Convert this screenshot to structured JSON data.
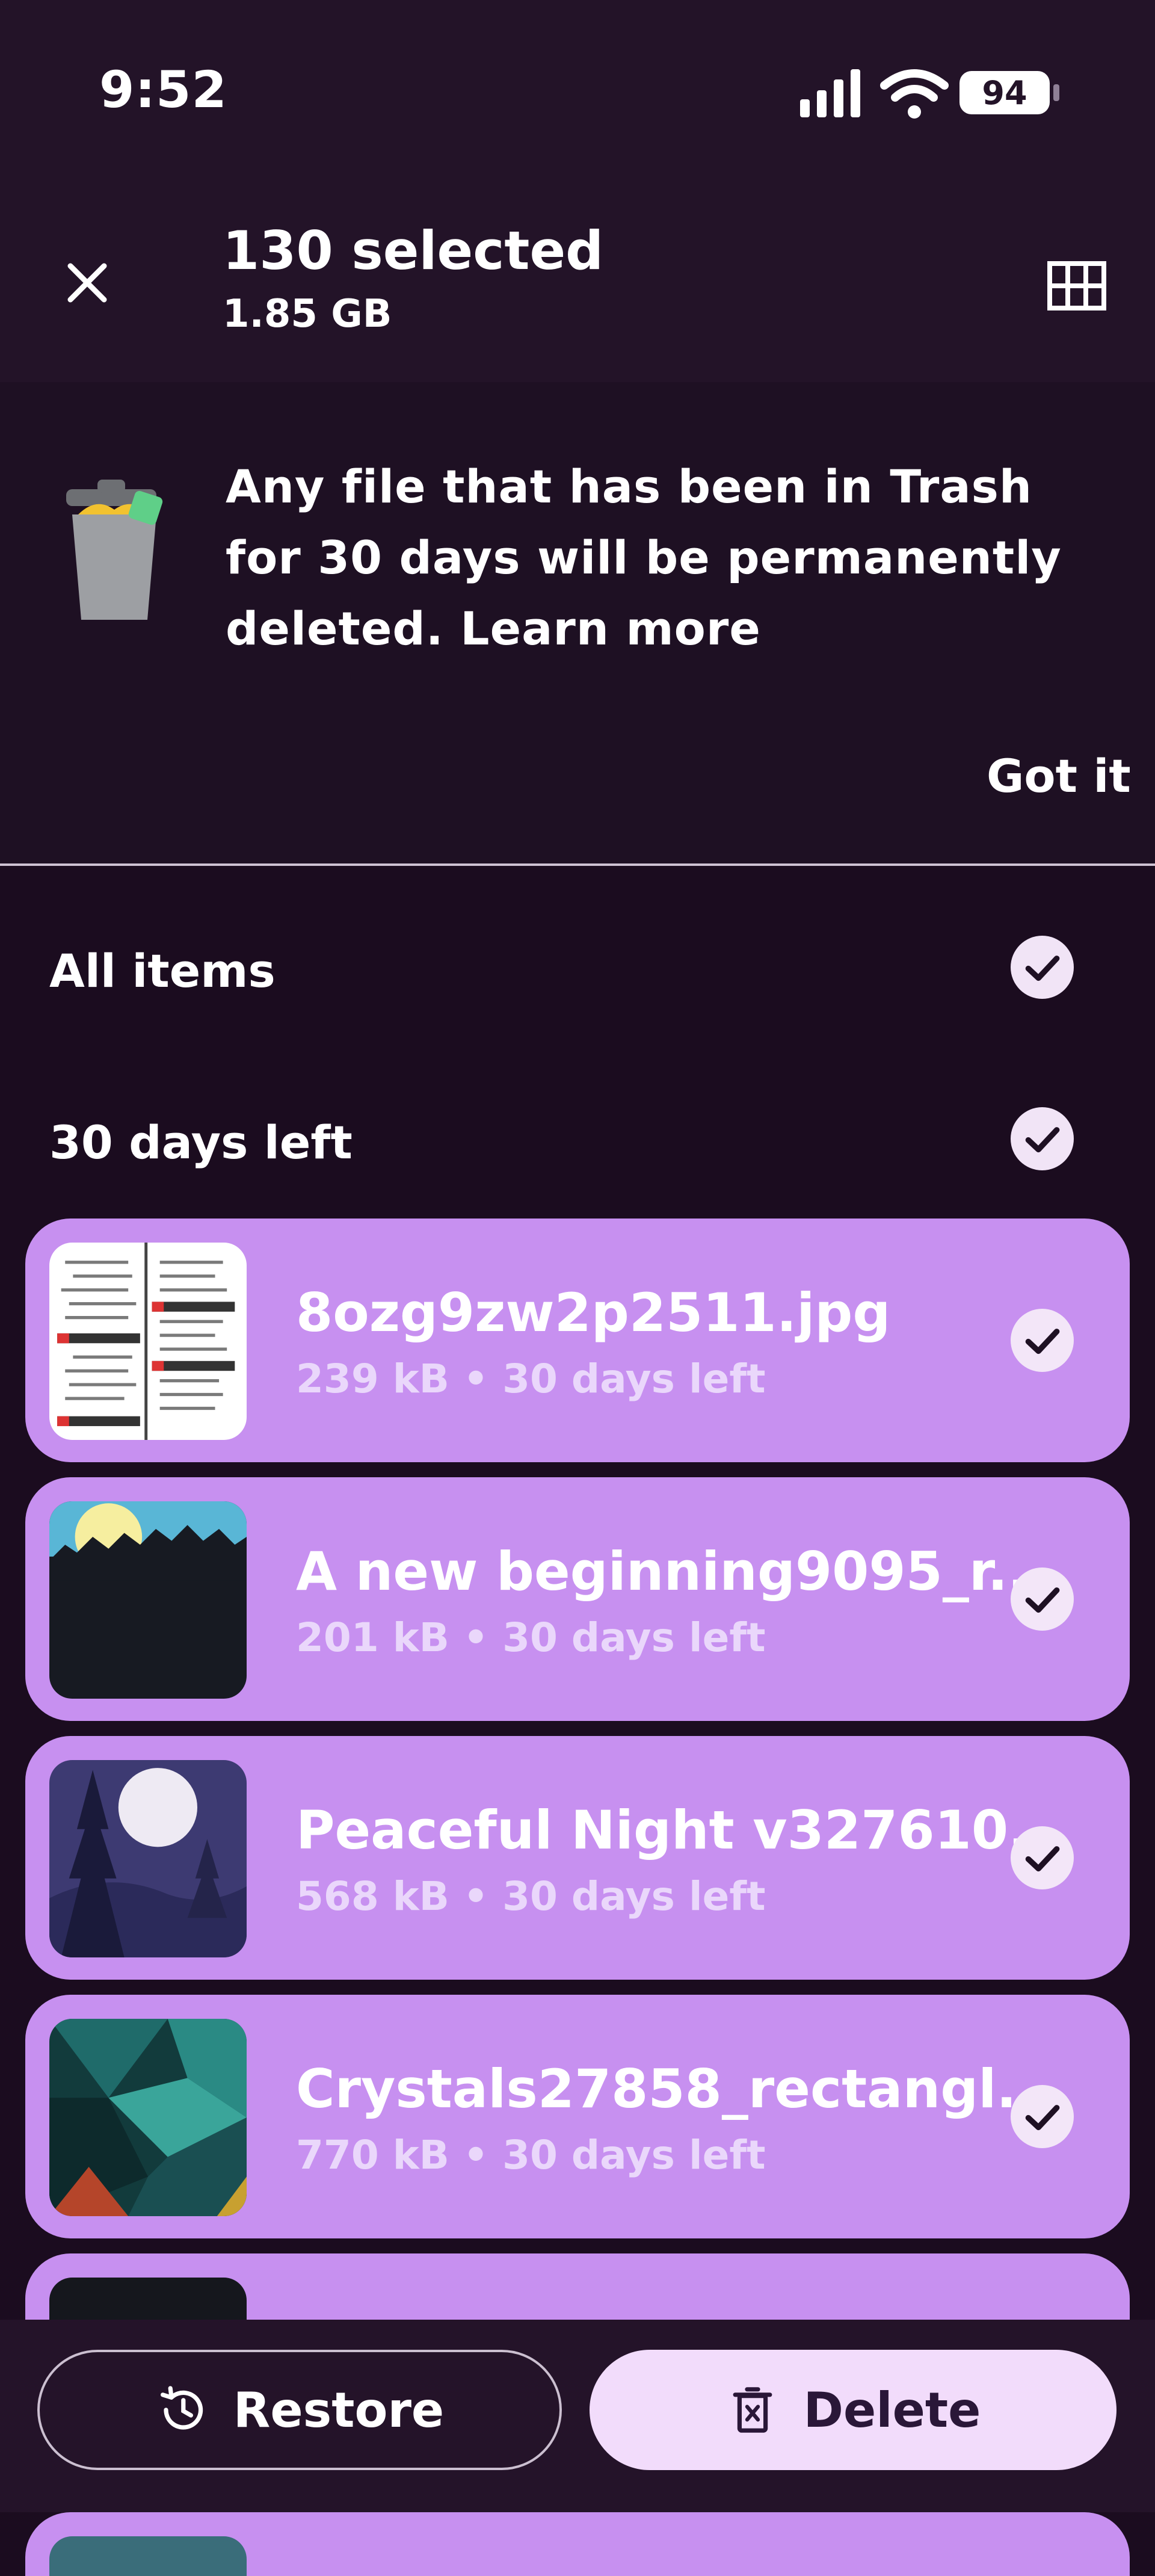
{
  "status_bar": {
    "time": "9:52",
    "battery": "94"
  },
  "header": {
    "title": "130 selected",
    "subtitle": "1.85 GB"
  },
  "banner": {
    "message": "Any file that has been in Trash for 30 days will be permanently deleted. Learn more",
    "action_label": "Got it"
  },
  "sections": [
    {
      "label": "All items"
    },
    {
      "label": "30 days left"
    }
  ],
  "files": [
    {
      "name": "8ozg9zw2p2511.jpg",
      "meta": "239 kB • 30 days left"
    },
    {
      "name": "A new beginning9095_r...",
      "meta": "201 kB • 30 days left"
    },
    {
      "name": "Peaceful Night v327610...",
      "meta": "568 kB • 30 days left"
    },
    {
      "name": "Crystals27858_rectangl...",
      "meta": "770 kB • 30 days left"
    }
  ],
  "actions": {
    "restore_label": "Restore",
    "delete_label": "Delete"
  },
  "colors": {
    "background": "#1b0c1f",
    "card": "#c790f0",
    "delete_button": "#f2dcfb"
  }
}
